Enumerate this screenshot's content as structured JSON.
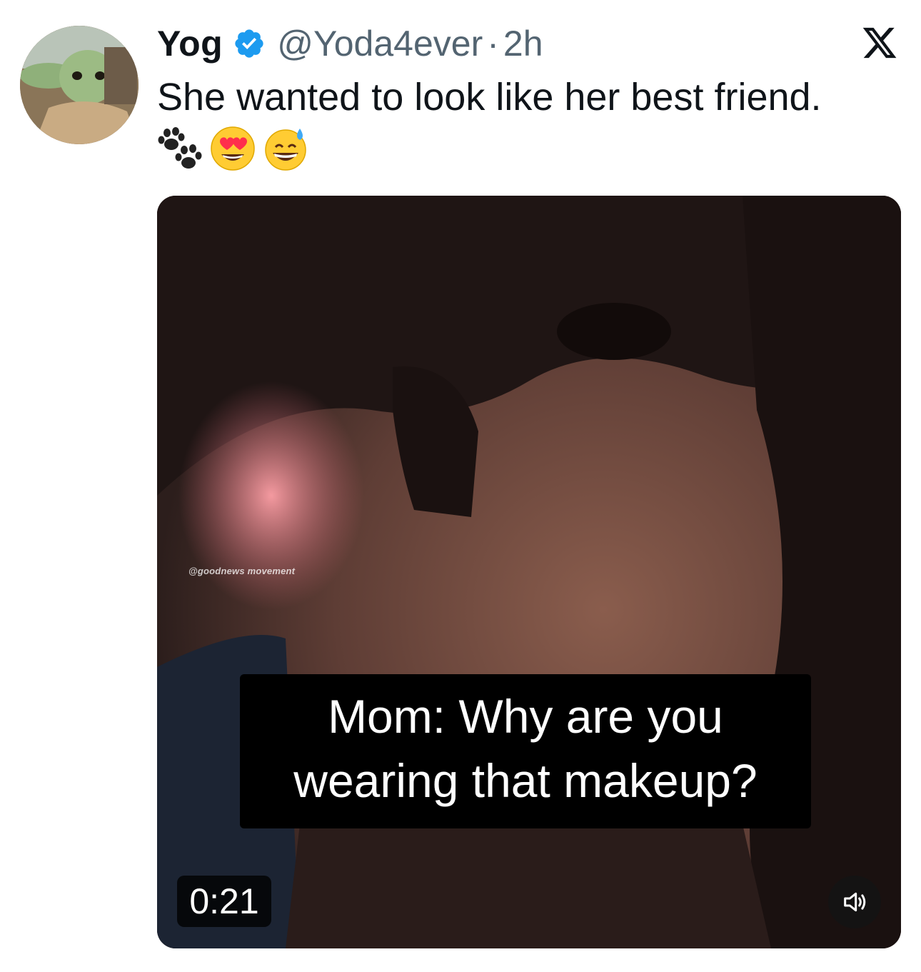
{
  "author": {
    "display_name": "Yog",
    "handle": "@Yoda4ever",
    "separator": "·",
    "time": "2h"
  },
  "icons": {
    "verified": "verified-badge-icon",
    "platform": "x-logo-icon",
    "emojis": [
      "paw-prints-emoji",
      "heart-eyes-emoji",
      "grinning-sweat-emoji"
    ],
    "volume": "speaker-icon"
  },
  "colors": {
    "verified_blue": "#1d9bf0",
    "secondary_text": "#536471",
    "primary_text": "#0f1419"
  },
  "tweet": {
    "text": "She wanted to look like her best friend."
  },
  "video": {
    "watermark": "@goodnews movement",
    "caption_line1": "Mom: Why are you",
    "caption_line2": "wearing that makeup?",
    "duration": "0:21"
  }
}
